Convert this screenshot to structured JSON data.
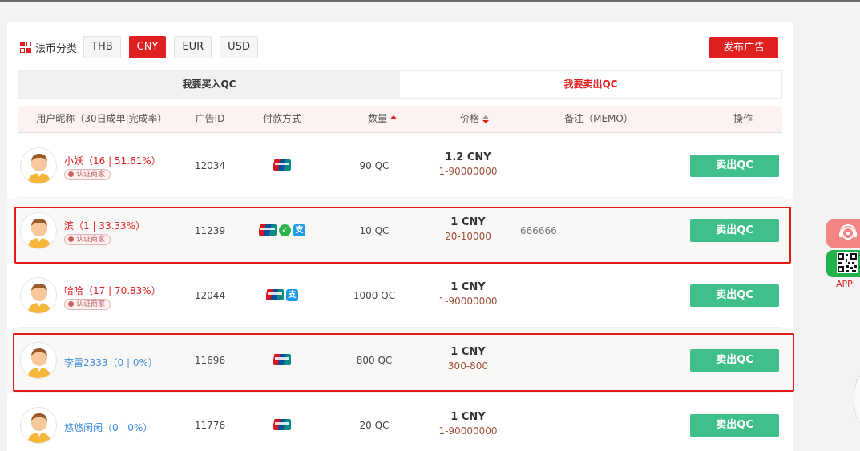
{
  "filter": {
    "label": "法币分类",
    "currencies": [
      "THB",
      "CNY",
      "EUR",
      "USD"
    ],
    "active": "CNY"
  },
  "publish_label": "发布广告",
  "tabs": {
    "buy": "我要买入QC",
    "sell": "我要卖出QC",
    "active": "sell"
  },
  "table": {
    "headers": {
      "user": "用户昵称（30日成单|完成率）",
      "ad_id": "广告ID",
      "payment": "付款方式",
      "quantity": "数量",
      "price": "价格",
      "memo": "备注（MEMO）",
      "action": "操作"
    },
    "rows": [
      {
        "name": "小妖（16 | 51.61%）",
        "name_color": "red",
        "verified": "认证商家",
        "ad_id": "12034",
        "payments": [
          "unionpay-icon"
        ],
        "quantity": "90 QC",
        "price": "1.2 CNY",
        "limit": "1-90000000",
        "memo": "",
        "action": "卖出QC",
        "highlighted": false
      },
      {
        "name": "滨（1 | 33.33%）",
        "name_color": "red",
        "verified": "认证商家",
        "ad_id": "11239",
        "payments": [
          "unionpay-icon",
          "wechat-pay-icon",
          "alipay-icon"
        ],
        "quantity": "10 QC",
        "price": "1 CNY",
        "limit": "20-10000",
        "memo": "666666",
        "action": "卖出QC",
        "highlighted": true
      },
      {
        "name": "哈哈（17 | 70.83%）",
        "name_color": "red",
        "verified": "认证商家",
        "ad_id": "12044",
        "payments": [
          "unionpay-icon",
          "alipay-icon"
        ],
        "quantity": "1000 QC",
        "price": "1 CNY",
        "limit": "1-90000000",
        "memo": "",
        "action": "卖出QC",
        "highlighted": false
      },
      {
        "name": "李雷2333（0 | 0%）",
        "name_color": "blue",
        "verified": "",
        "ad_id": "11696",
        "payments": [
          "unionpay-icon"
        ],
        "quantity": "800 QC",
        "price": "1 CNY",
        "limit": "300-800",
        "memo": "",
        "action": "卖出QC",
        "highlighted": true
      },
      {
        "name": "悠悠闲闲（0 | 0%）",
        "name_color": "blue",
        "verified": "",
        "ad_id": "11776",
        "payments": [
          "unionpay-icon"
        ],
        "quantity": "20 QC",
        "price": "1 CNY",
        "limit": "1-90000000",
        "memo": "",
        "action": "卖出QC",
        "highlighted": false
      }
    ]
  },
  "side": {
    "app_label": "APP"
  },
  "colors": {
    "accent": "#e02020",
    "sell_button": "#3fc08a",
    "highlight_border": "#e21a1a"
  }
}
